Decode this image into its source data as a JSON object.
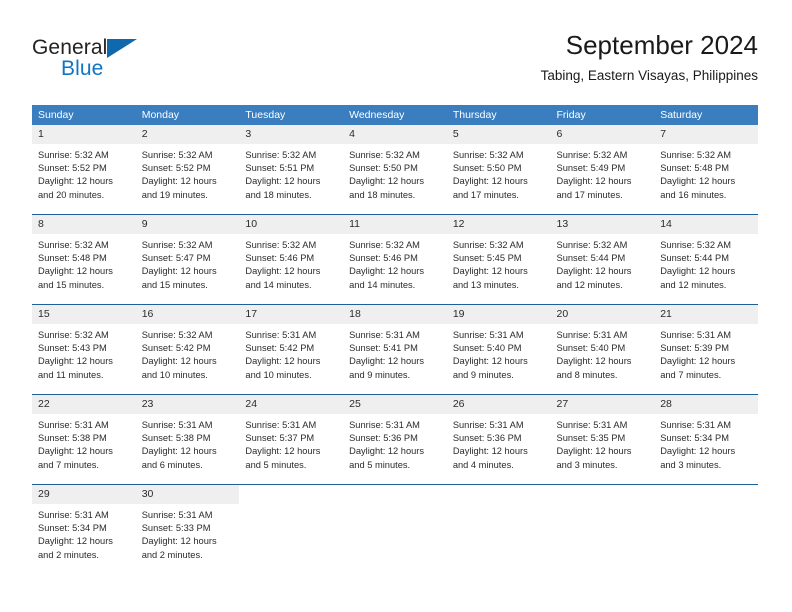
{
  "logo": {
    "word_one": "General",
    "word_two": "Blue",
    "triangle_icon": "triangle-icon"
  },
  "header": {
    "month_title": "September 2024",
    "location": "Tabing, Eastern Visayas, Philippines"
  },
  "calendar": {
    "day_headers": [
      "Sunday",
      "Monday",
      "Tuesday",
      "Wednesday",
      "Thursday",
      "Friday",
      "Saturday"
    ],
    "header_bg": "#3a7ebf",
    "date_row_bg": "#efefef",
    "week_divider": "#1f6099",
    "weeks": [
      {
        "days": [
          {
            "date": "1",
            "sunrise": "Sunrise: 5:32 AM",
            "sunset": "Sunset: 5:52 PM",
            "daylight_1": "Daylight: 12 hours",
            "daylight_2": "and 20 minutes."
          },
          {
            "date": "2",
            "sunrise": "Sunrise: 5:32 AM",
            "sunset": "Sunset: 5:52 PM",
            "daylight_1": "Daylight: 12 hours",
            "daylight_2": "and 19 minutes."
          },
          {
            "date": "3",
            "sunrise": "Sunrise: 5:32 AM",
            "sunset": "Sunset: 5:51 PM",
            "daylight_1": "Daylight: 12 hours",
            "daylight_2": "and 18 minutes."
          },
          {
            "date": "4",
            "sunrise": "Sunrise: 5:32 AM",
            "sunset": "Sunset: 5:50 PM",
            "daylight_1": "Daylight: 12 hours",
            "daylight_2": "and 18 minutes."
          },
          {
            "date": "5",
            "sunrise": "Sunrise: 5:32 AM",
            "sunset": "Sunset: 5:50 PM",
            "daylight_1": "Daylight: 12 hours",
            "daylight_2": "and 17 minutes."
          },
          {
            "date": "6",
            "sunrise": "Sunrise: 5:32 AM",
            "sunset": "Sunset: 5:49 PM",
            "daylight_1": "Daylight: 12 hours",
            "daylight_2": "and 17 minutes."
          },
          {
            "date": "7",
            "sunrise": "Sunrise: 5:32 AM",
            "sunset": "Sunset: 5:48 PM",
            "daylight_1": "Daylight: 12 hours",
            "daylight_2": "and 16 minutes."
          }
        ]
      },
      {
        "days": [
          {
            "date": "8",
            "sunrise": "Sunrise: 5:32 AM",
            "sunset": "Sunset: 5:48 PM",
            "daylight_1": "Daylight: 12 hours",
            "daylight_2": "and 15 minutes."
          },
          {
            "date": "9",
            "sunrise": "Sunrise: 5:32 AM",
            "sunset": "Sunset: 5:47 PM",
            "daylight_1": "Daylight: 12 hours",
            "daylight_2": "and 15 minutes."
          },
          {
            "date": "10",
            "sunrise": "Sunrise: 5:32 AM",
            "sunset": "Sunset: 5:46 PM",
            "daylight_1": "Daylight: 12 hours",
            "daylight_2": "and 14 minutes."
          },
          {
            "date": "11",
            "sunrise": "Sunrise: 5:32 AM",
            "sunset": "Sunset: 5:46 PM",
            "daylight_1": "Daylight: 12 hours",
            "daylight_2": "and 14 minutes."
          },
          {
            "date": "12",
            "sunrise": "Sunrise: 5:32 AM",
            "sunset": "Sunset: 5:45 PM",
            "daylight_1": "Daylight: 12 hours",
            "daylight_2": "and 13 minutes."
          },
          {
            "date": "13",
            "sunrise": "Sunrise: 5:32 AM",
            "sunset": "Sunset: 5:44 PM",
            "daylight_1": "Daylight: 12 hours",
            "daylight_2": "and 12 minutes."
          },
          {
            "date": "14",
            "sunrise": "Sunrise: 5:32 AM",
            "sunset": "Sunset: 5:44 PM",
            "daylight_1": "Daylight: 12 hours",
            "daylight_2": "and 12 minutes."
          }
        ]
      },
      {
        "days": [
          {
            "date": "15",
            "sunrise": "Sunrise: 5:32 AM",
            "sunset": "Sunset: 5:43 PM",
            "daylight_1": "Daylight: 12 hours",
            "daylight_2": "and 11 minutes."
          },
          {
            "date": "16",
            "sunrise": "Sunrise: 5:32 AM",
            "sunset": "Sunset: 5:42 PM",
            "daylight_1": "Daylight: 12 hours",
            "daylight_2": "and 10 minutes."
          },
          {
            "date": "17",
            "sunrise": "Sunrise: 5:31 AM",
            "sunset": "Sunset: 5:42 PM",
            "daylight_1": "Daylight: 12 hours",
            "daylight_2": "and 10 minutes."
          },
          {
            "date": "18",
            "sunrise": "Sunrise: 5:31 AM",
            "sunset": "Sunset: 5:41 PM",
            "daylight_1": "Daylight: 12 hours",
            "daylight_2": "and 9 minutes."
          },
          {
            "date": "19",
            "sunrise": "Sunrise: 5:31 AM",
            "sunset": "Sunset: 5:40 PM",
            "daylight_1": "Daylight: 12 hours",
            "daylight_2": "and 9 minutes."
          },
          {
            "date": "20",
            "sunrise": "Sunrise: 5:31 AM",
            "sunset": "Sunset: 5:40 PM",
            "daylight_1": "Daylight: 12 hours",
            "daylight_2": "and 8 minutes."
          },
          {
            "date": "21",
            "sunrise": "Sunrise: 5:31 AM",
            "sunset": "Sunset: 5:39 PM",
            "daylight_1": "Daylight: 12 hours",
            "daylight_2": "and 7 minutes."
          }
        ]
      },
      {
        "days": [
          {
            "date": "22",
            "sunrise": "Sunrise: 5:31 AM",
            "sunset": "Sunset: 5:38 PM",
            "daylight_1": "Daylight: 12 hours",
            "daylight_2": "and 7 minutes."
          },
          {
            "date": "23",
            "sunrise": "Sunrise: 5:31 AM",
            "sunset": "Sunset: 5:38 PM",
            "daylight_1": "Daylight: 12 hours",
            "daylight_2": "and 6 minutes."
          },
          {
            "date": "24",
            "sunrise": "Sunrise: 5:31 AM",
            "sunset": "Sunset: 5:37 PM",
            "daylight_1": "Daylight: 12 hours",
            "daylight_2": "and 5 minutes."
          },
          {
            "date": "25",
            "sunrise": "Sunrise: 5:31 AM",
            "sunset": "Sunset: 5:36 PM",
            "daylight_1": "Daylight: 12 hours",
            "daylight_2": "and 5 minutes."
          },
          {
            "date": "26",
            "sunrise": "Sunrise: 5:31 AM",
            "sunset": "Sunset: 5:36 PM",
            "daylight_1": "Daylight: 12 hours",
            "daylight_2": "and 4 minutes."
          },
          {
            "date": "27",
            "sunrise": "Sunrise: 5:31 AM",
            "sunset": "Sunset: 5:35 PM",
            "daylight_1": "Daylight: 12 hours",
            "daylight_2": "and 3 minutes."
          },
          {
            "date": "28",
            "sunrise": "Sunrise: 5:31 AM",
            "sunset": "Sunset: 5:34 PM",
            "daylight_1": "Daylight: 12 hours",
            "daylight_2": "and 3 minutes."
          }
        ]
      },
      {
        "days": [
          {
            "date": "29",
            "sunrise": "Sunrise: 5:31 AM",
            "sunset": "Sunset: 5:34 PM",
            "daylight_1": "Daylight: 12 hours",
            "daylight_2": "and 2 minutes."
          },
          {
            "date": "30",
            "sunrise": "Sunrise: 5:31 AM",
            "sunset": "Sunset: 5:33 PM",
            "daylight_1": "Daylight: 12 hours",
            "daylight_2": "and 2 minutes."
          },
          {
            "date": "",
            "sunrise": "",
            "sunset": "",
            "daylight_1": "",
            "daylight_2": ""
          },
          {
            "date": "",
            "sunrise": "",
            "sunset": "",
            "daylight_1": "",
            "daylight_2": ""
          },
          {
            "date": "",
            "sunrise": "",
            "sunset": "",
            "daylight_1": "",
            "daylight_2": ""
          },
          {
            "date": "",
            "sunrise": "",
            "sunset": "",
            "daylight_1": "",
            "daylight_2": ""
          },
          {
            "date": "",
            "sunrise": "",
            "sunset": "",
            "daylight_1": "",
            "daylight_2": ""
          }
        ]
      }
    ]
  }
}
